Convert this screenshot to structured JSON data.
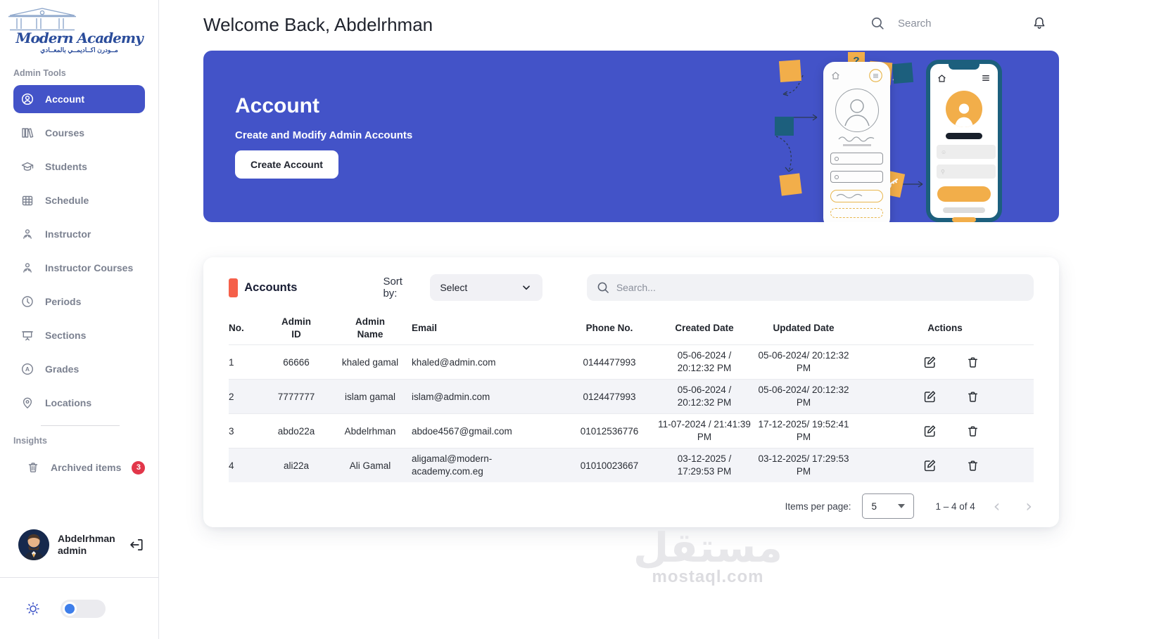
{
  "logo": {
    "name": "Modern Academy",
    "arabic": "مــودرن اكــاديمــي بالمعــادي"
  },
  "topbar": {
    "welcome_title": "Welcome Back, Abdelrhman",
    "search_placeholder": "Search"
  },
  "sidebar": {
    "section_admin_tools": "Admin Tools",
    "section_insights": "Insights",
    "items": [
      {
        "label": "Account",
        "icon": "user-circle-icon",
        "active": true
      },
      {
        "label": "Courses",
        "icon": "books-icon"
      },
      {
        "label": "Students",
        "icon": "graduation-cap-icon"
      },
      {
        "label": "Schedule",
        "icon": "calendar-icon"
      },
      {
        "label": "Instructor",
        "icon": "instructor-icon"
      },
      {
        "label": "Instructor Courses",
        "icon": "instructor-courses-icon"
      },
      {
        "label": "Periods",
        "icon": "clock-icon"
      },
      {
        "label": "Sections",
        "icon": "board-icon"
      },
      {
        "label": "Grades",
        "icon": "grade-a-icon"
      },
      {
        "label": "Locations",
        "icon": "map-pin-icon"
      }
    ],
    "archived": {
      "label": "Archived items",
      "badge": "3"
    },
    "user": {
      "name": "Abdelrhman",
      "role": "admin"
    }
  },
  "hero": {
    "title": "Account",
    "subtitle": "Create and Modify Admin Accounts",
    "cta_label": "Create Account",
    "bg_color": "#4353c8",
    "question_mark": "?"
  },
  "accounts_card": {
    "title": "Accounts",
    "sort_label": "Sort by:",
    "sort_value": "Select",
    "search_placeholder": "Search...",
    "columns": {
      "no": "No.",
      "admin_id": "Admin ID",
      "admin_name": "Admin Name",
      "email": "Email",
      "phone": "Phone No.",
      "created": "Created Date",
      "updated": "Updated Date",
      "actions": "Actions"
    },
    "rows": [
      {
        "no": "1",
        "admin_id": "66666",
        "admin_name": "khaled gamal",
        "email": "khaled@admin.com",
        "phone": "0144477993",
        "created": "05-06-2024 / 20:12:32 PM",
        "updated": "05-06-2024/ 20:12:32 PM"
      },
      {
        "no": "2",
        "admin_id": "7777777",
        "admin_name": "islam gamal",
        "email": "islam@admin.com",
        "phone": "0124477993",
        "created": "05-06-2024 / 20:12:32 PM",
        "updated": "05-06-2024/ 20:12:32 PM"
      },
      {
        "no": "3",
        "admin_id": "abdo22a",
        "admin_name": "Abdelrhman",
        "email": "abdoe4567@gmail.com",
        "phone": "01012536776",
        "created": "11-07-2024 / 21:41:39 PM",
        "updated": "17-12-2025/ 19:52:41 PM"
      },
      {
        "no": "4",
        "admin_id": "ali22a",
        "admin_name": "Ali Gamal",
        "email": "aligamal@modern-academy.com.eg",
        "phone": "01010023667",
        "created": "03-12-2025 / 17:29:53 PM",
        "updated": "03-12-2025/ 17:29:53 PM"
      }
    ],
    "pagination": {
      "items_per_page_label": "Items per page:",
      "items_per_page_value": "5",
      "range_label": "1 – 4 of 4"
    }
  },
  "watermark": {
    "arabic": "مستقل",
    "domain": "mostaql.com"
  },
  "colors": {
    "accent_blue": "#4353c8",
    "marker_orange": "#f5604a",
    "badge_red": "#e23649",
    "sticky_orange": "#f2ae4a",
    "sticky_teal": "#1c5f7d"
  }
}
